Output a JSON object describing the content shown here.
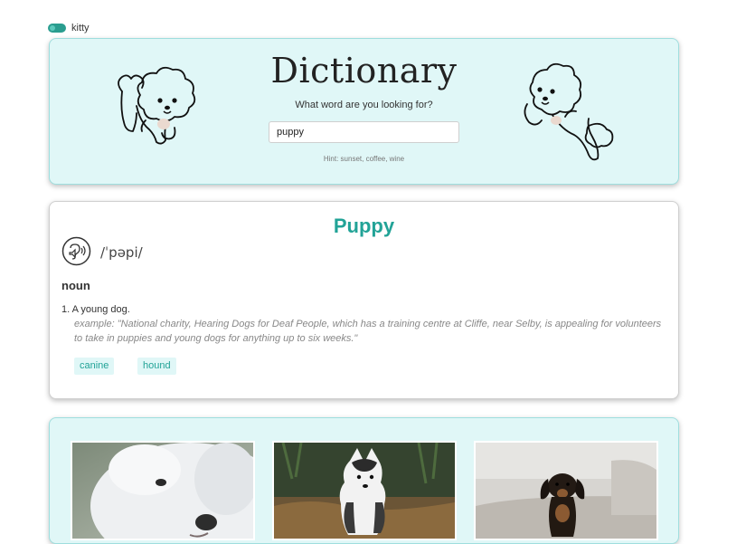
{
  "theme_toggle": {
    "label": "kitty"
  },
  "header": {
    "title": "Dictionary",
    "subtitle": "What word are you looking for?",
    "search": {
      "value": "puppy",
      "placeholder": ""
    },
    "hint": "Hint: sunset, coffee, wine"
  },
  "result": {
    "word": "Puppy",
    "phonetic": "/ˈpəpi/",
    "meanings": [
      {
        "part_of_speech": "noun",
        "definition": "1. A young dog.",
        "example": "example: \"National charity, Hearing Dogs for Deaf People, which has a training centre at Cliffe, near Selby, is appealing for volunteers to take in puppies and young dogs for anything up to six weeks.\"",
        "synonyms": [
          "canine",
          "hound"
        ]
      }
    ]
  },
  "photos": [
    {
      "alt": "white fluffy puppy"
    },
    {
      "alt": "husky puppy in grass"
    },
    {
      "alt": "dachshund puppy on sofa"
    }
  ],
  "colors": {
    "accent": "#22a397",
    "panel": "#e0f7f7"
  },
  "icons": {
    "audio": "speaker-ear-icon",
    "toggle": "toggle-switch-icon"
  }
}
